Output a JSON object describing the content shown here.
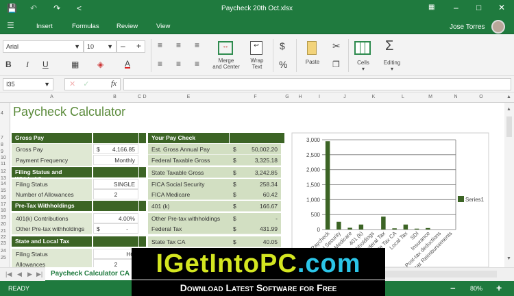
{
  "window": {
    "title": "Paycheck 20th Oct.xlsx"
  },
  "menu": {
    "items": [
      "Insert",
      "Formulas",
      "Review",
      "View"
    ],
    "user": "Jose Torres"
  },
  "ribbon": {
    "font": "Arial",
    "size": "10",
    "merge": "Merge\nand Center",
    "merge_l1": "Merge",
    "merge_l2": "and Center",
    "wrap_l1": "Wrap",
    "wrap_l2": "Text",
    "paste": "Paste",
    "cells": "Cells",
    "editing": "Editing",
    "currency": "$",
    "percent": "%"
  },
  "formula": {
    "cell_ref": "I35",
    "fx": "fx",
    "value": ""
  },
  "columns": [
    "A",
    "B",
    "C",
    "D",
    "E",
    "F",
    "G",
    "H",
    "I",
    "J",
    "K",
    "L",
    "M",
    "N",
    "O"
  ],
  "rows": [
    "4",
    "7",
    "8",
    "9",
    "10",
    "11",
    "12",
    "13",
    "14",
    "15",
    "16",
    "17",
    "18",
    "19",
    "20",
    "21",
    "22",
    "23",
    "24",
    "25"
  ],
  "sheet": {
    "title": "Paycheck Calculator",
    "gross_pay_header": "Gross Pay",
    "gross_pay": {
      "label": "Gross Pay",
      "cur": "$",
      "value": "4,166.85"
    },
    "payment_frequency": {
      "label": "Payment Frequency",
      "value": "Monthly"
    },
    "filing_header": "Filing Status and Withholding",
    "filing_status": {
      "label": "Filing Status",
      "value": "SINGLE"
    },
    "allowances": {
      "label": "Number of Allowances",
      "value": "2"
    },
    "pretax_header": "Pre-Tax Withholdings",
    "contrib": {
      "label": "401(k) Contributions",
      "value": "4.00%"
    },
    "other_pretax": {
      "label": "Other Pre-tax withholdings",
      "cur": "$",
      "value": "-"
    },
    "state_header": "State and Local Tax",
    "state_filing": {
      "label": "Filing Status",
      "value": "HO"
    },
    "state_allow": {
      "label": "Allowances",
      "value": "2"
    },
    "paycheck_header": "Your Pay Check",
    "paycheck": [
      {
        "label": "Est. Gross Annual Pay",
        "cur": "$",
        "value": "50,002.20"
      },
      {
        "label": "Federal Taxable Gross",
        "cur": "$",
        "value": "3,325.18"
      },
      {
        "label": "State Taxable Gross",
        "cur": "$",
        "value": "3,242.85"
      },
      {
        "label": "FICA Social Security",
        "cur": "$",
        "value": "258.34"
      },
      {
        "label": "FICA Medicare",
        "cur": "$",
        "value": "60.42"
      },
      {
        "label": "401 (k)",
        "cur": "$",
        "value": "166.67"
      },
      {
        "label": "Other Pre-tax withholdings",
        "cur": "$",
        "value": "-"
      },
      {
        "label": "Federal Tax",
        "cur": "$",
        "value": "431.99"
      },
      {
        "label": "State Tax CA",
        "cur": "$",
        "value": "40.05"
      }
    ]
  },
  "chart_data": {
    "type": "bar",
    "categories": [
      "Paycheck",
      "Social Security",
      "Medicare",
      "401 (k)",
      "Other Pre-tax withholdings",
      "Federal Tax",
      "State Tax CA",
      "Local Tax",
      "SDI",
      "Insurance",
      "Other Post-tax deductions",
      "Post-tax Reimbursements"
    ],
    "series": [
      {
        "name": "Series1",
        "values": [
          2950,
          258,
          60,
          167,
          0,
          432,
          40,
          167,
          30,
          50,
          0,
          0
        ]
      }
    ],
    "yticks": [
      "0",
      "500",
      "1,000",
      "1,500",
      "2,000",
      "2,500",
      "3,000"
    ],
    "ylim": [
      0,
      3000
    ],
    "grid": true,
    "legend": "right",
    "color": "#3c6425"
  },
  "tabs": {
    "active": "Paycheck Calculator CA"
  },
  "status": {
    "text": "READY",
    "zoom": "80%",
    "minus": "−",
    "plus": "+"
  },
  "watermark": {
    "line1": "IGetIntoPC",
    "line1b": ".com",
    "line2": "Download Latest Software for Free"
  }
}
